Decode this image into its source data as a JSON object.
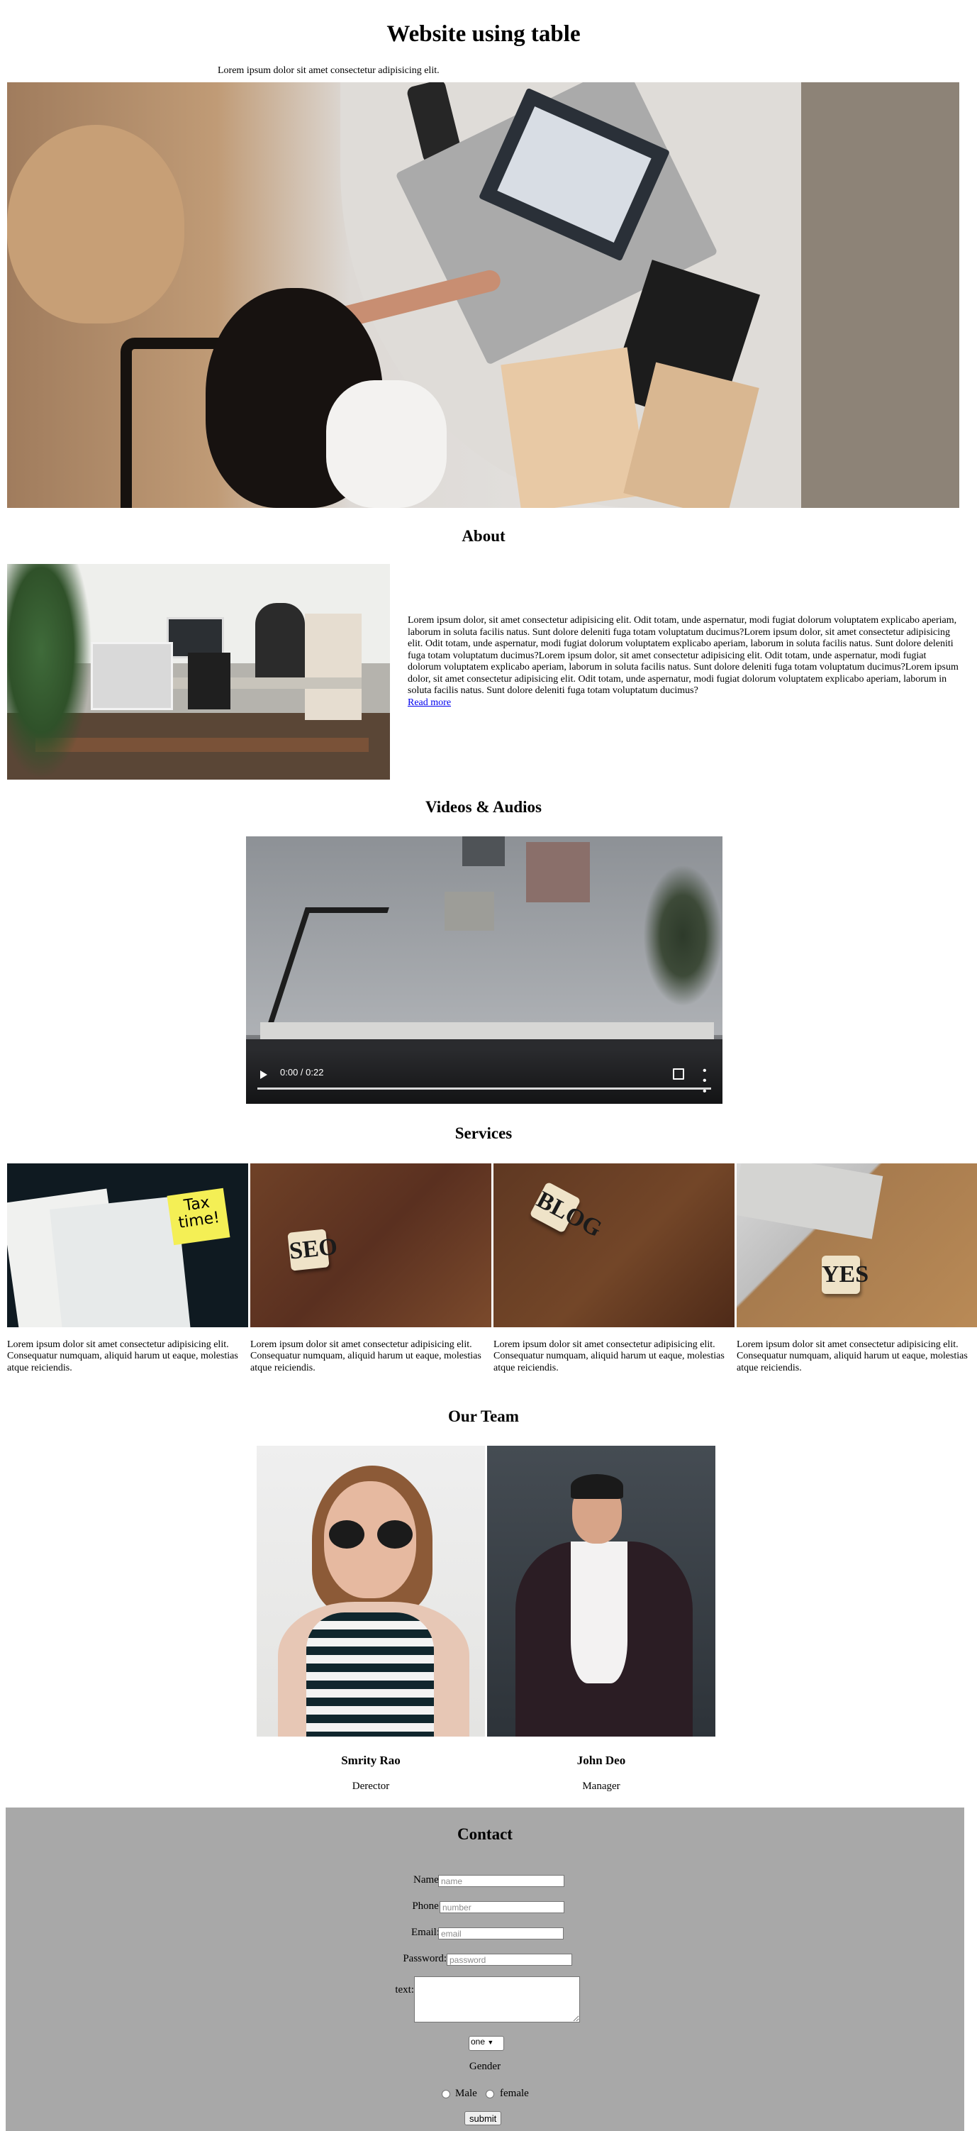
{
  "page": {
    "title": "Website using table",
    "subtitle": "Lorem ipsum dolor sit amet consectetur adipisicing elit."
  },
  "about": {
    "heading": "About",
    "paragraph": "Lorem ipsum dolor, sit amet consectetur adipisicing elit. Odit totam, unde aspernatur, modi fugiat dolorum voluptatem explicabo aperiam, laborum in soluta facilis natus. Sunt dolore deleniti fuga totam voluptatum ducimus?Lorem ipsum dolor, sit amet consectetur adipisicing elit. Odit totam, unde aspernatur, modi fugiat dolorum voluptatem explicabo aperiam, laborum in soluta facilis natus. Sunt dolore deleniti fuga totam voluptatum ducimus?Lorem ipsum dolor, sit amet consectetur adipisicing elit. Odit totam, unde aspernatur, modi fugiat dolorum voluptatem explicabo aperiam, laborum in soluta facilis natus. Sunt dolore deleniti fuga totam voluptatum ducimus?Lorem ipsum dolor, sit amet consectetur adipisicing elit. Odit totam, unde aspernatur, modi fugiat dolorum voluptatem explicabo aperiam, laborum in soluta facilis natus. Sunt dolore deleniti fuga totam voluptatum ducimus?",
    "link": "Read more"
  },
  "media": {
    "heading": "Videos & Audios",
    "time": "0:00 / 0:22",
    "progress": 0
  },
  "services": {
    "heading": "Services",
    "items": [
      {
        "text": "Lorem ipsum dolor sit amet consectetur adipisicing elit. Consequatur numquam, aliquid harum ut eaque, molestias atque reiciendis.",
        "note": "Tax time!"
      },
      {
        "text": "Lorem ipsum dolor sit amet consectetur adipisicing elit. Consequatur numquam, aliquid harum ut eaque, molestias atque reiciendis.",
        "tiles": "SEO"
      },
      {
        "text": "Lorem ipsum dolor sit amet consectetur adipisicing elit. Consequatur numquam, aliquid harum ut eaque, molestias atque reiciendis.",
        "tiles": "BLOG"
      },
      {
        "text": "Lorem ipsum dolor sit amet consectetur adipisicing elit. Consequatur numquam, aliquid harum ut eaque, molestias atque reiciendis.",
        "tiles": "YES"
      }
    ]
  },
  "team": {
    "heading": "Our Team",
    "members": [
      {
        "name": "Smrity Rao",
        "role": "Derector"
      },
      {
        "name": "John Deo",
        "role": "Manager"
      }
    ]
  },
  "contact": {
    "heading": "Contact",
    "name_label": "Name:",
    "name_placeholder": "name",
    "phone_label": "Phone:",
    "phone_placeholder": "number",
    "email_label": "Email:",
    "email_placeholder": "email",
    "password_label": "Password:",
    "password_placeholder": "password",
    "text_label": "text:",
    "select_value": "one",
    "gender_label": "Gender",
    "male_label": "Male",
    "female_label": "female",
    "submit_label": "submit",
    "background": "#a8a8a8"
  }
}
